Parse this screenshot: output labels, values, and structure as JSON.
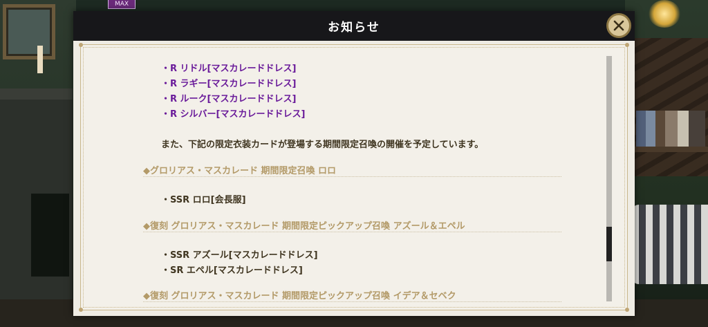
{
  "background": {
    "max_badge": "MAX"
  },
  "dialog": {
    "title": "お知らせ",
    "close_icon": "close-icon"
  },
  "notice": {
    "costume_cards": [
      "・R リドル[マスカレードドレス]",
      "・R ラギー[マスカレードドレス]",
      "・R ルーク[マスカレードドレス]",
      "・R シルバー[マスカレードドレス]"
    ],
    "summon_intro": "また、下記の限定衣装カードが登場する期間限定召喚の開催を予定しています。",
    "sections": [
      {
        "heading": "◆グロリアス・マスカレード 期間限定召喚 ロロ",
        "items": [
          "・SSR ロロ[会長服]"
        ]
      },
      {
        "heading": "◆復刻 グロリアス・マスカレード 期間限定ピックアップ召喚 アズール＆エペル",
        "items": [
          "・SSR アズール[マスカレードドレス]",
          "・SR エペル[マスカレードドレス]"
        ]
      },
      {
        "heading": "◆復刻 グロリアス・マスカレード 期間限定ピックアップ召喚 イデア＆セベク",
        "items": []
      }
    ]
  },
  "colors": {
    "title_bar": "#17171a",
    "link_purple": "#6a1b9a",
    "section_gold": "#b39a68",
    "close_button": "#d9c79a"
  }
}
